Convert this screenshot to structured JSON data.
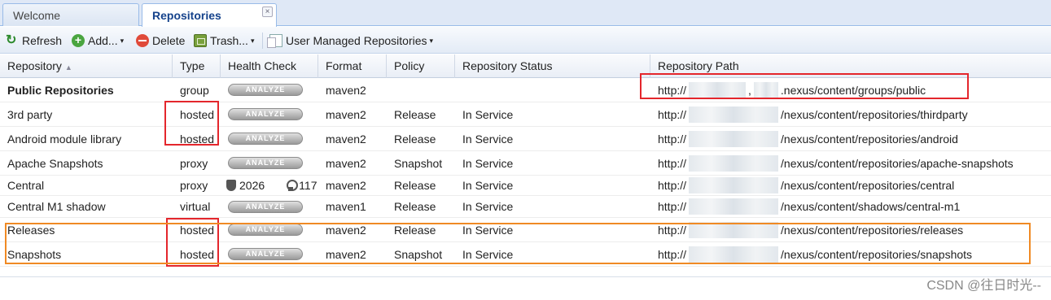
{
  "tabs": [
    {
      "label": "Welcome"
    },
    {
      "label": "Repositories",
      "close": "×"
    }
  ],
  "toolbar": {
    "refresh": "Refresh",
    "add": "Add...",
    "delete": "Delete",
    "trash": "Trash...",
    "user_managed": "User Managed Repositories",
    "dropdown_glyph": "▾"
  },
  "columns": [
    "Repository",
    "Type",
    "Health Check",
    "Format",
    "Policy",
    "Repository Status",
    "Repository Path"
  ],
  "sort_glyph": "▲",
  "analyze_label": "ANALYZE",
  "rows": [
    {
      "name": "Public Repositories",
      "type": "group",
      "format": "maven2",
      "policy": "",
      "status": "",
      "path_prefix": "http://",
      "path_sep": ",",
      "path_suffix": ".nexus/content/groups/public"
    },
    {
      "name": "3rd party",
      "type": "hosted",
      "format": "maven2",
      "policy": "Release",
      "status": "In Service",
      "path_prefix": "http://",
      "path_suffix": "/nexus/content/repositories/thirdparty"
    },
    {
      "name": "Android module library",
      "type": "hosted",
      "format": "maven2",
      "policy": "Release",
      "status": "In Service",
      "path_prefix": "http://",
      "path_suffix": "/nexus/content/repositories/android"
    },
    {
      "name": "Apache Snapshots",
      "type": "proxy",
      "format": "maven2",
      "policy": "Snapshot",
      "status": "In Service",
      "path_prefix": "http://",
      "path_suffix": "/nexus/content/repositories/apache-snapshots"
    },
    {
      "name": "Central",
      "type": "proxy",
      "format": "maven2",
      "policy": "Release",
      "status": "In Service",
      "path_prefix": "http://",
      "path_suffix": "/nexus/content/repositories/central",
      "health_a": "2026",
      "health_b": "117"
    },
    {
      "name": "Central M1 shadow",
      "type": "virtual",
      "format": "maven1",
      "policy": "Release",
      "status": "In Service",
      "path_prefix": "http://",
      "path_suffix": "/nexus/content/shadows/central-m1"
    },
    {
      "name": "Releases",
      "type": "hosted",
      "format": "maven2",
      "policy": "Release",
      "status": "In Service",
      "path_prefix": "http://",
      "path_suffix": "/nexus/content/repositories/releases"
    },
    {
      "name": "Snapshots",
      "type": "hosted",
      "format": "maven2",
      "policy": "Snapshot",
      "status": "In Service",
      "path_prefix": "http://",
      "path_suffix": "/nexus/content/repositories/snapshots"
    }
  ],
  "watermark": "CSDN @往日时光--",
  "colors": {
    "highlight_red": "#e4262c",
    "highlight_orange": "#f08a24",
    "header_blue": "#15428b"
  }
}
